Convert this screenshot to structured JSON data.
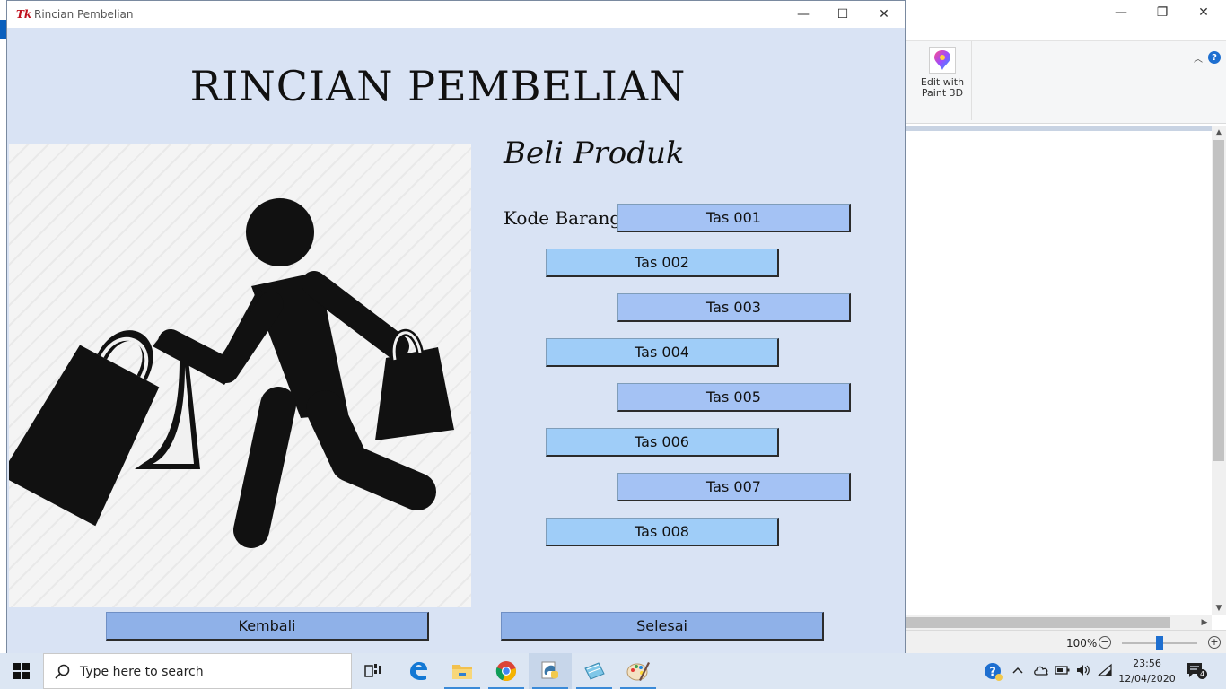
{
  "tk_window": {
    "title": "Rincian Pembelian",
    "logo": "Tk",
    "controls": {
      "minimize": "—",
      "maximize": "☐",
      "close": "✕"
    }
  },
  "heading": "RINCIAN PEMBELIAN",
  "illustration_icon": "shopper-with-bags-icon",
  "subheading": "Beli Produk",
  "kode_label": "Kode Barang",
  "products": [
    "Tas 001",
    "Tas 002",
    "Tas 003",
    "Tas 004",
    "Tas 005",
    "Tas 006",
    "Tas 007",
    "Tas 008"
  ],
  "footer_buttons": {
    "back": "Kembali",
    "finish": "Selesai"
  },
  "paint_window": {
    "controls": {
      "minimize": "—",
      "restore": "❐",
      "close": "✕"
    },
    "help": "?",
    "edit_paint3d": [
      "Edit with",
      "Paint 3D"
    ],
    "zoom": "100%",
    "zoom_out": "−",
    "zoom_in": "+"
  },
  "taskbar": {
    "search_placeholder": "Type here to search",
    "apps": [
      "task-view-icon",
      "edge-icon",
      "file-explorer-icon",
      "chrome-icon",
      "python-icon",
      "notepad-icon",
      "paint-icon"
    ],
    "clock_time": "23:56",
    "clock_date": "12/04/2020",
    "notification_count": "4"
  },
  "colors": {
    "window_bg": "#d9e3f4",
    "button_a": "#a4c2f4",
    "button_b": "#9fcdf8",
    "footer_button": "#8fb1e8",
    "taskbar": "#dce6f3"
  }
}
